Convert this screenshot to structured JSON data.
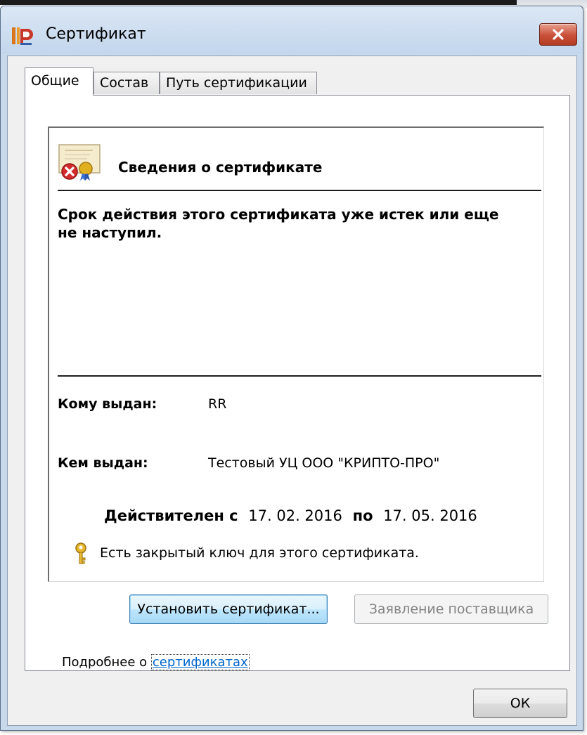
{
  "window": {
    "title": "Сертификат",
    "close_icon": "close-x-icon",
    "app_icon": "cryptopro-icon"
  },
  "tabs": [
    {
      "label": "Общие",
      "active": true
    },
    {
      "label": "Состав",
      "active": false
    },
    {
      "label": "Путь сертификации",
      "active": false
    }
  ],
  "info": {
    "heading": "Сведения о сертификате",
    "warning": "Срок действия этого сертификата уже истек или еще не наступил.",
    "issued_to_label": "Кому выдан:",
    "issued_to_value": "RR",
    "issued_by_label": "Кем выдан:",
    "issued_by_value": "Тестовый УЦ ООО \"КРИПТО-ПРО\"",
    "valid_from_label": "Действителен с",
    "valid_from": "17. 02. 2016",
    "valid_to_label": "по",
    "valid_to": "17. 05. 2016",
    "private_key_note": "Есть закрытый ключ для этого сертификата.",
    "icons": {
      "certificate": "certificate-error-icon",
      "key": "key-icon"
    }
  },
  "buttons": {
    "install": "Установить сертификат...",
    "issuer_statement": "Заявление поставщика",
    "ok": "ОК"
  },
  "more": {
    "prefix": "Подробнее о ",
    "link": "сертификатах"
  },
  "colors": {
    "title_bar": "#c9d9ec",
    "close_button": "#c8503a",
    "link": "#0066cc"
  }
}
